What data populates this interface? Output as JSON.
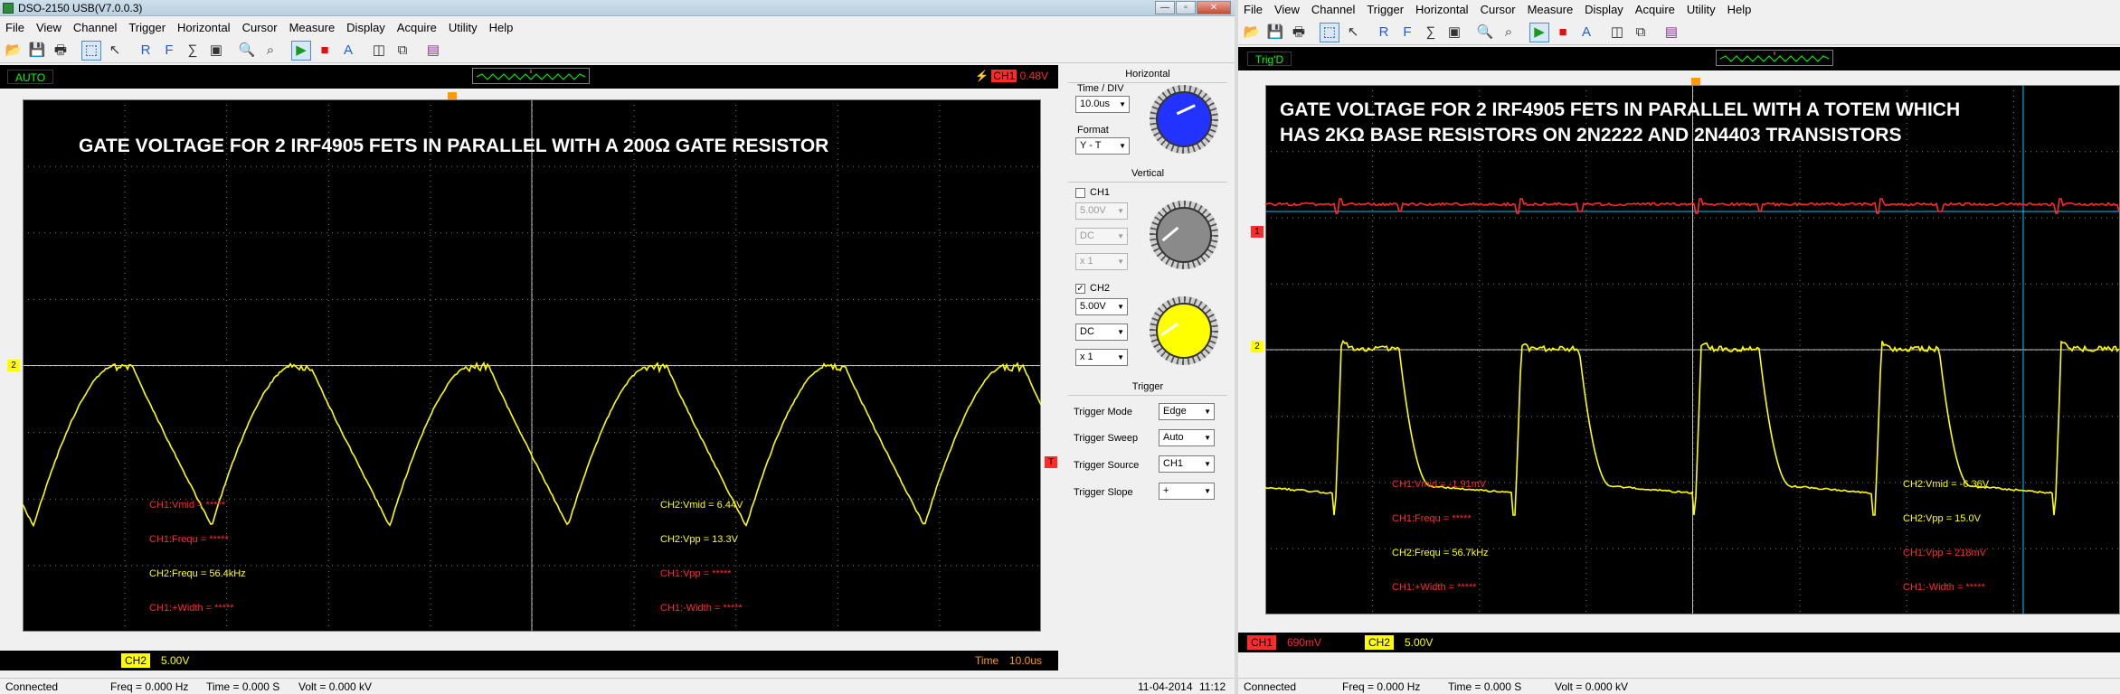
{
  "window_left": {
    "title": "DSO-2150 USB(V7.0.0.3)",
    "window_buttons": [
      "—",
      "▫",
      "✕"
    ],
    "menu": [
      "File",
      "View",
      "Channel",
      "Trigger",
      "Horizontal",
      "Cursor",
      "Measure",
      "Display",
      "Acquire",
      "Utility",
      "Help"
    ],
    "mode_badge": "AUTO",
    "trigger_level": "0.48V",
    "caption": "GATE VOLTAGE FOR 2 IRF4905 FETS IN PARALLEL WITH A 200Ω GATE RESISTOR",
    "measurements": {
      "ch1_vmid": "CH1:Vmid = *****",
      "ch1_frequ": "CH1:Frequ = *****",
      "ch2_frequ": "CH2:Frequ = 56.4kHz",
      "ch1_pwidth": "CH1:+Width = *****",
      "ch2_vmid": "CH2:Vmid = 6.44V",
      "ch2_vpp": "CH2:Vpp = 13.3V",
      "ch1_vpp": "CH1:Vpp = *****",
      "ch1_nwidth": "CH1:-Width = *****"
    },
    "footer": {
      "ch2_label": "CH2",
      "ch2_scale": "5.00V",
      "time_label": "Time",
      "time_value": "10.0us"
    },
    "ch_marker": "2",
    "trig_marker": "T",
    "status": {
      "state": "Connected",
      "freq": "Freq = 0.000 Hz",
      "time": "Time = 0.000 S",
      "volt": "Volt = 0.000 kV",
      "date": "11-04-2014",
      "clock": "11:12"
    },
    "panel": {
      "horizontal_title": "Horizontal",
      "time_div_label": "Time / DIV",
      "time_div_value": "10.0us",
      "format_label": "Format",
      "format_value": "Y - T",
      "vertical_title": "Vertical",
      "ch1_label": "CH1",
      "ch1_volts": "5.00V",
      "ch1_coupling": "DC",
      "ch1_probe": "x 1",
      "ch2_label": "CH2",
      "ch2_volts": "5.00V",
      "ch2_coupling": "DC",
      "ch2_probe": "x 1",
      "trigger_title": "Trigger",
      "trigger_mode_label": "Trigger Mode",
      "trigger_mode_value": "Edge",
      "trigger_sweep_label": "Trigger Sweep",
      "trigger_sweep_value": "Auto",
      "trigger_source_label": "Trigger Source",
      "trigger_source_value": "CH1",
      "trigger_slope_label": "Trigger Slope",
      "trigger_slope_value": "+",
      "ch1_checked": false,
      "ch2_checked": true,
      "knob_colors": {
        "horizontal": "#2233ff",
        "ch1": "#8a8a8a",
        "ch2": "#ffff00"
      }
    }
  },
  "window_right": {
    "menu": [
      "File",
      "View",
      "Channel",
      "Trigger",
      "Horizontal",
      "Cursor",
      "Measure",
      "Display",
      "Acquire",
      "Utility",
      "Help"
    ],
    "mode_badge": "Trig'D",
    "caption": "GATE VOLTAGE FOR 2 IRF4905 FETS IN PARALLEL WITH A TOTEM WHICH\nHAS 2KΩ BASE RESISTORS ON 2N2222 AND 2N4403 TRANSISTORS",
    "measurements": {
      "ch1_vmid": "CH1:Vmid = -1.91mV",
      "ch1_frequ": "CH1:Frequ = *****",
      "ch2_frequ": "CH2:Frequ = 56.7kHz",
      "ch1_pwidth": "CH1:+Width = *****",
      "ch2_vmid": "CH2:Vmid = -6.36V",
      "ch2_vpp": "CH2:Vpp = 15.0V",
      "ch1_vpp": "CH1:Vpp = 218mV",
      "ch1_nwidth": "CH1:-Width = *****"
    },
    "footer": {
      "ch1_label": "CH1",
      "ch1_scale": "690mV",
      "ch2_label": "CH2",
      "ch2_scale": "5.00V"
    },
    "ch1_marker": "1",
    "ch2_marker": "2",
    "status": {
      "state": "Connected",
      "freq": "Freq = 0.000 Hz",
      "time": "Time = 0.000 S",
      "volt": "Volt = 0.000 kV"
    }
  },
  "toolbar_icons": [
    "open-icon",
    "save-icon",
    "print-icon",
    "select-icon",
    "pointer-icon",
    "reference-icon",
    "fft-icon",
    "math-icon",
    "display-icon",
    "zoom-in-icon",
    "zoom-out-icon",
    "run-icon",
    "stop-icon",
    "auto-icon",
    "snapshot-icon",
    "capture-icon",
    "book-icon"
  ],
  "colors": {
    "ch1": "#ff2a2a",
    "ch2": "#ffff00",
    "grid": "#808080",
    "screen_bg": "#000000"
  }
}
